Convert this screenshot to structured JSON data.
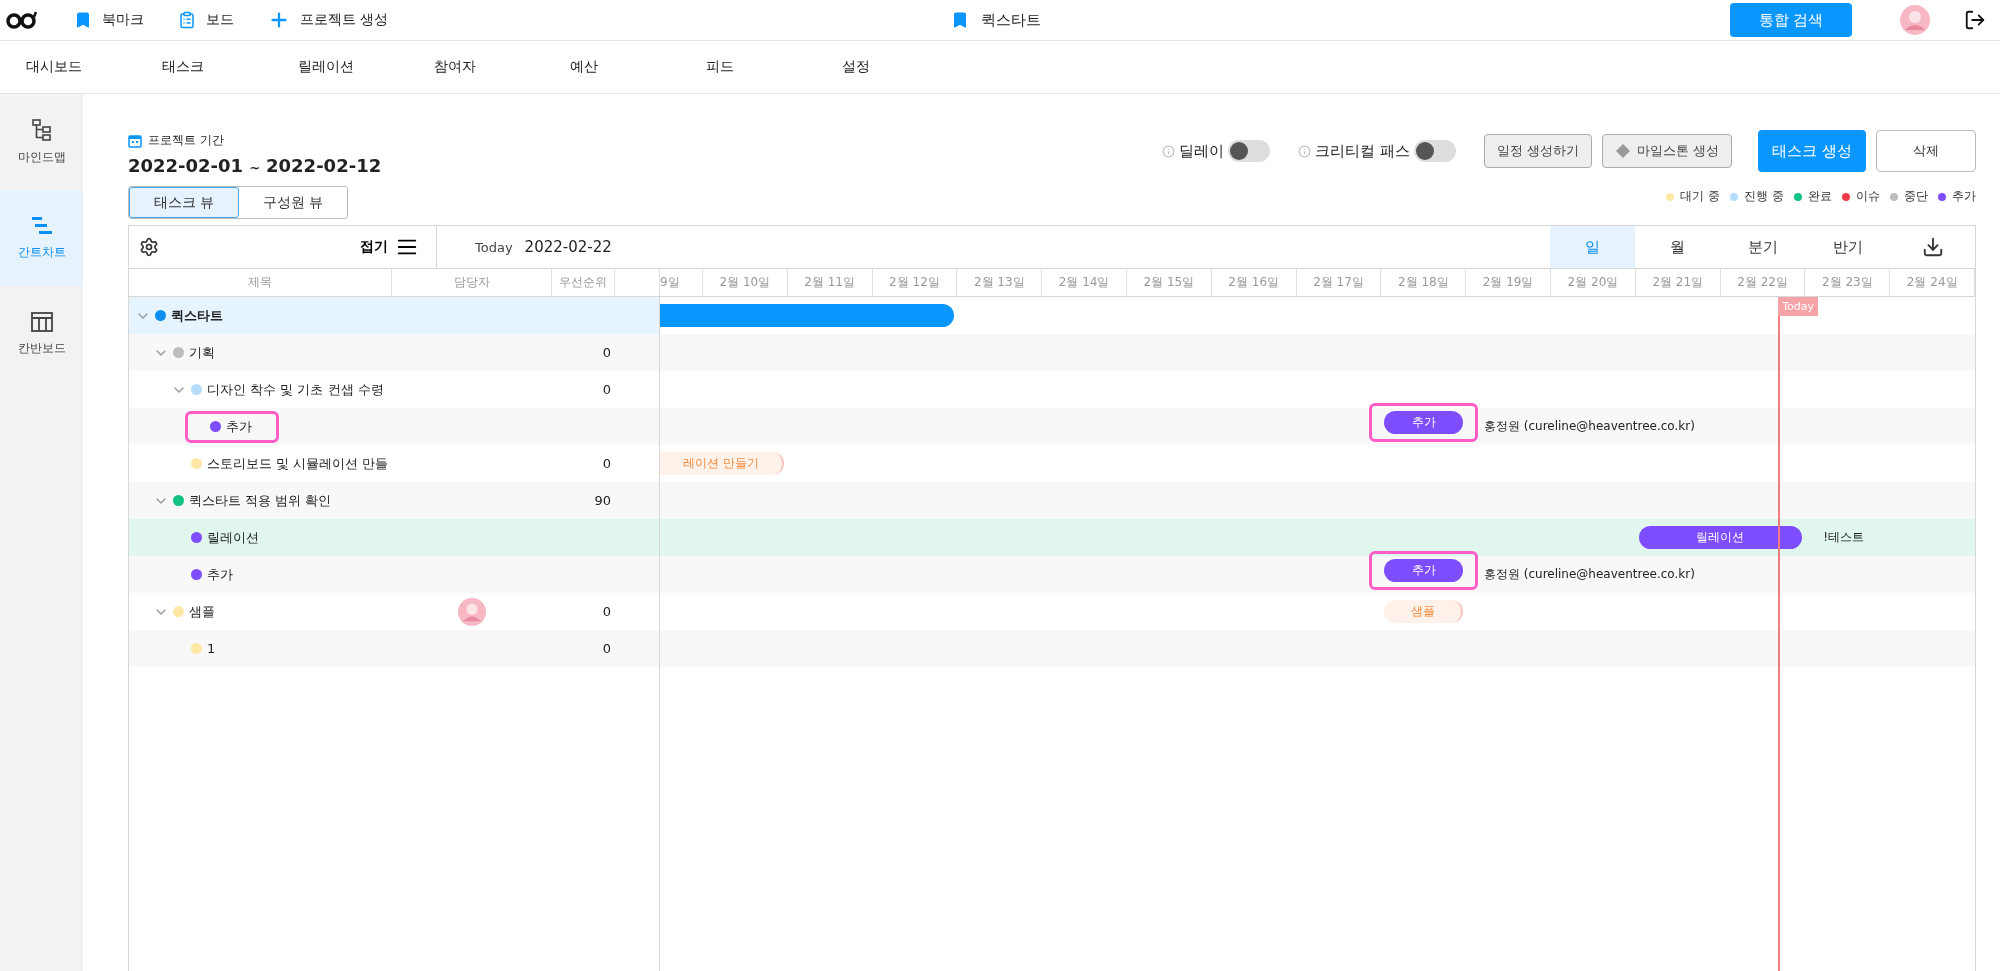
{
  "topbar": {
    "links": [
      {
        "label": "북마크"
      },
      {
        "label": "보드"
      },
      {
        "label": "프로젝트 생성"
      }
    ],
    "project": "퀵스타트",
    "search_button": "통합 검색"
  },
  "nav": [
    {
      "label": "대시보드"
    },
    {
      "label": "태스크"
    },
    {
      "label": "릴레이션"
    },
    {
      "label": "참여자"
    },
    {
      "label": "예산"
    },
    {
      "label": "피드"
    },
    {
      "label": "설정"
    }
  ],
  "sidebar": [
    {
      "label": "마인드맵",
      "selected": false
    },
    {
      "label": "간트차트",
      "selected": true
    },
    {
      "label": "칸반보드",
      "selected": false
    }
  ],
  "period": {
    "label": "프로젝트 기간",
    "range_start": "2022-02-01",
    "separator": "~",
    "range_end": "2022-02-12"
  },
  "view_tabs": [
    {
      "label": "태스크 뷰",
      "selected": true
    },
    {
      "label": "구성원 뷰",
      "selected": false
    }
  ],
  "toggles": [
    {
      "label": "딜레이",
      "on": false
    },
    {
      "label": "크리티컬 패스",
      "on": false
    }
  ],
  "buttons": [
    {
      "label": "일정 생성하기",
      "kind": "gray"
    },
    {
      "label": "마일스톤 생성",
      "kind": "milestone"
    },
    {
      "label": "태스크 생성",
      "kind": "primary"
    },
    {
      "label": "삭제",
      "kind": "outline"
    }
  ],
  "legend": [
    {
      "label": "대기 중",
      "color": "#fde7a6"
    },
    {
      "label": "진행 중",
      "color": "#b5dcfa"
    },
    {
      "label": "완료",
      "color": "#12c283"
    },
    {
      "label": "이슈",
      "color": "#f03a4a"
    },
    {
      "label": "중단",
      "color": "#bdbdbd"
    },
    {
      "label": "추가",
      "color": "#7d4dff"
    }
  ],
  "gantt": {
    "collapse": "접기",
    "today_label": "Today",
    "today": "2022-02-22",
    "today_marker": "Today",
    "scales": [
      {
        "label": "일",
        "selected": true
      },
      {
        "label": "월",
        "selected": false
      },
      {
        "label": "분기",
        "selected": false
      },
      {
        "label": "반기",
        "selected": false
      }
    ],
    "columns": [
      "제목",
      "담당자",
      "우선순위"
    ],
    "days": [
      "9일",
      "2월 10일",
      "2월 11일",
      "2월 12일",
      "2월 13일",
      "2월 14일",
      "2월 15일",
      "2월 16일",
      "2월 17일",
      "2월 18일",
      "2월 19일",
      "2월 20일",
      "2월 21일",
      "2월 22일",
      "2월 23일",
      "2월 24일"
    ],
    "rows": [
      {
        "title": "퀵스타트",
        "color": "#0a8ef0",
        "selected": true,
        "hovered": false,
        "marked": false,
        "expanded": true,
        "bar": {
          "kind": "solid",
          "color": "#0a96ff",
          "marked": false
        },
        "children": [
          {
            "title": "기획",
            "color": "#bdbdbd",
            "priority": "0",
            "selected": false,
            "hovered": false,
            "marked": false,
            "expanded": true,
            "children": [
              {
                "title": "디자인 착수 및 기초 컨샙 수령",
                "color": "#b5dcfa",
                "priority": "0",
                "selected": false,
                "hovered": false,
                "marked": false,
                "expanded": true,
                "children": [
                  {
                    "title": "추가",
                    "color": "#7d4dff",
                    "selected": false,
                    "hovered": false,
                    "marked": true,
                    "bar": {
                      "kind": "solid",
                      "color": "#7d4dff",
                      "label": "추가",
                      "marked": true
                    },
                    "note": "홍정원 (cureline@heaventree.co.kr)"
                  }
                ]
              },
              {
                "title": "스토리보드 및 시뮬레이션 만들",
                "color": "#fde7a6",
                "priority": "0",
                "selected": false,
                "hovered": false,
                "marked": false,
                "bar": {
                  "kind": "soft",
                  "color": "#f28a3c",
                  "label": "레이션 만들기",
                  "marked": false
                }
              }
            ]
          },
          {
            "title": "퀵스타트 적용 범위 확인",
            "color": "#12c283",
            "priority": "90",
            "selected": false,
            "hovered": false,
            "marked": false,
            "expanded": true,
            "children": [
              {
                "title": "릴레이션",
                "color": "#7d4dff",
                "selected": false,
                "hovered": true,
                "marked": false,
                "bar": {
                  "kind": "solid",
                  "color": "#7d4dff",
                  "label": "릴레이션",
                  "marked": false
                },
                "note": "!테스트"
              },
              {
                "title": "추가",
                "color": "#7d4dff",
                "selected": false,
                "hovered": false,
                "marked": false,
                "bar": {
                  "kind": "solid",
                  "color": "#7d4dff",
                  "label": "추가",
                  "marked": true
                },
                "note": "홍정원 (cureline@heaventree.co.kr)"
              }
            ]
          },
          {
            "title": "샘플",
            "color": "#fde7a6",
            "priority": "0",
            "avatar": true,
            "selected": false,
            "hovered": false,
            "marked": false,
            "expanded": true,
            "bar": {
              "kind": "soft",
              "color": "#f28a3c",
              "label": "샘플",
              "marked": false
            },
            "children": [
              {
                "title": "1",
                "color": "#fde7a6",
                "priority": "0",
                "selected": false,
                "hovered": false,
                "marked": false
              }
            ]
          }
        ]
      }
    ]
  }
}
